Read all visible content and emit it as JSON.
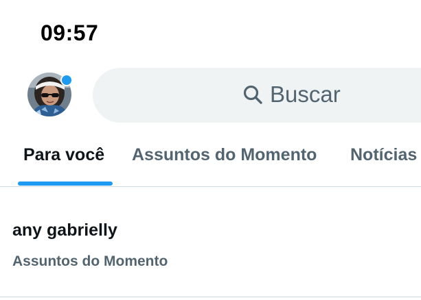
{
  "status_bar": {
    "time": "09:57"
  },
  "header": {
    "avatar_icon": "profile-avatar",
    "notification_dot_color": "#1d9bf0",
    "search": {
      "icon": "search-icon",
      "placeholder": "Buscar"
    }
  },
  "tabs": [
    {
      "label": "Para você",
      "active": true
    },
    {
      "label": "Assuntos do Momento",
      "active": false
    },
    {
      "label": "Notícias",
      "active": false
    }
  ],
  "trend": {
    "title": "any gabrielly",
    "category": "Assuntos do Momento"
  },
  "colors": {
    "accent": "#1d9bf0",
    "text_primary": "#0f1419",
    "text_secondary": "#536471",
    "search_bg": "#eff3f4",
    "divider": "#cfd9de"
  }
}
